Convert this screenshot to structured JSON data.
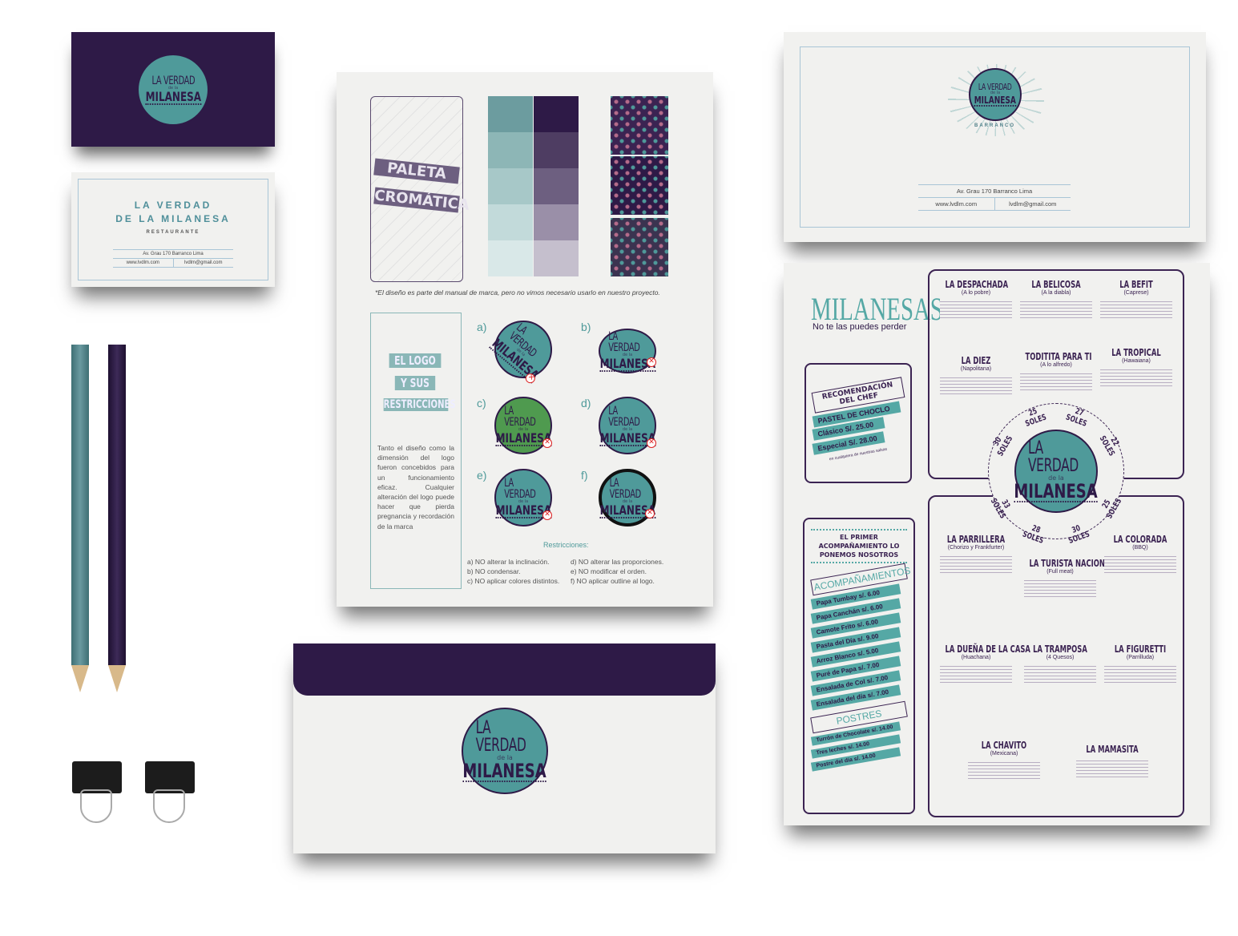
{
  "logo": {
    "line1": "LA VERDAD",
    "line2": "de la",
    "line3": "MILANESA",
    "tag": "Barranco"
  },
  "business_card": {
    "title1": "LA VERDAD",
    "title2": "DE LA MILANESA",
    "subtitle": "RESTAURANTE",
    "address": "Av. Grau 170 Barranco Lima",
    "web": "www.lvdlm.com",
    "email": "lvdlm@gmail.com"
  },
  "letterhead": {
    "location": "BARRANCO",
    "address": "Av. Grau 170 Barranco Lima",
    "web": "www.lvdlm.com",
    "email": "lvdlm@gmail.com"
  },
  "brand_sheet": {
    "palette_title1": "PALETA",
    "palette_title2": "CROMÁTICA",
    "footnote": "*El diseño es parte del manual de marca, pero no vimos necesario usarlo en nuestro proyecto.",
    "logo_title1": "EL LOGO",
    "logo_title2": "Y SUS",
    "logo_title3": "RESTRICCIONES",
    "logo_text": "Tanto el diseño como la dimensión del logo fueron concebidos para un funcionamiento eficaz. Cualquier alteración del logo puede hacer que pierda pregnancia y recordación de la marca",
    "variants": [
      "a)",
      "b)",
      "c)",
      "d)",
      "e)",
      "f)"
    ],
    "restrictions_title": "Restricciones:",
    "restrictions": [
      "a) NO alterar la inclinación.",
      "b) NO condensar.",
      "c) NO aplicar colores distintos.",
      "d) NO alterar las proporciones.",
      "e) NO modificar el orden.",
      "f) NO aplicar outline al logo."
    ],
    "palette_colors": {
      "teal": [
        "#6c9c9f",
        "#8db6b6",
        "#a7c8c8",
        "#c2dada",
        "#d9e8e8"
      ],
      "purple": [
        "#2e1a47",
        "#4e3d62",
        "#6d5f80",
        "#9a8fa8",
        "#c5bfcd"
      ]
    }
  },
  "menu": {
    "title": "MILANESAS",
    "tagline": "No te las puedes perder",
    "chef": {
      "title": "RECOMENDACIÓN DEL CHEF",
      "dish": "PASTEL DE CHOCLO",
      "items": [
        "Clásico S/. 25.00",
        "Especial S/. 28.00"
      ],
      "note": "en cualquiera de nuestras salsas"
    },
    "sides_header": "EL PRIMER ACOMPAÑAMIENTO LO PONEMOS NOSOTROS",
    "sides_title": "ACOMPAÑAMIENTOS",
    "sides": [
      "Papa Tumbay s/. 6.00",
      "Papa Canchán s/. 6.00",
      "Camote Frito s/. 6.00",
      "Pasta del Día s/. 9.00",
      "Arroz Blanco s/. 5.00",
      "Puré de Papa s/. 7.00",
      "Ensalada de Col s/. 7.00",
      "Ensalada del día s/. 7.00"
    ],
    "desserts_title": "POSTRES",
    "desserts": [
      "Turrón de Chocolate s/. 14.00",
      "Tres leches s/. 14.00",
      "Postre del día s/. 14.00"
    ],
    "prices": [
      "30 SOLES",
      "25 SOLES",
      "27 SOLES",
      "22 SOLES",
      "33 SOLES",
      "28 SOLES",
      "30 SOLES",
      "25 SOLES"
    ],
    "top_items": [
      {
        "name": "LA DESPACHADA",
        "sub": "(A lo pobre)"
      },
      {
        "name": "LA BELICOSA",
        "sub": "(A la diabla)"
      },
      {
        "name": "LA BEFIT",
        "sub": "(Caprese)"
      },
      {
        "name": "LA DIEZ",
        "sub": "(Napolitana)"
      },
      {
        "name": "TODITITA PARA TI",
        "sub": "(A lo alfredo)"
      },
      {
        "name": "LA TROPICAL",
        "sub": "(Hawaiana)"
      }
    ],
    "bottom_items": [
      {
        "name": "LA PARRILLERA",
        "sub": "(Chorizo y Frankfurter)"
      },
      {
        "name": "LA TURISTA NACIONAL",
        "sub": "(Full meat)"
      },
      {
        "name": "LA COLORADA",
        "sub": "(BBQ)"
      },
      {
        "name": "LA DUEÑA DE LA CASA",
        "sub": "(Huachana)"
      },
      {
        "name": "LA TRAMPOSA",
        "sub": "(4 Quesos)"
      },
      {
        "name": "LA FIGURETTI",
        "sub": "(Parrilluda)"
      },
      {
        "name": "LA CHAVITO",
        "sub": "(Mexicana)"
      },
      {
        "name": "LA MAMASITA",
        "sub": ""
      }
    ]
  }
}
